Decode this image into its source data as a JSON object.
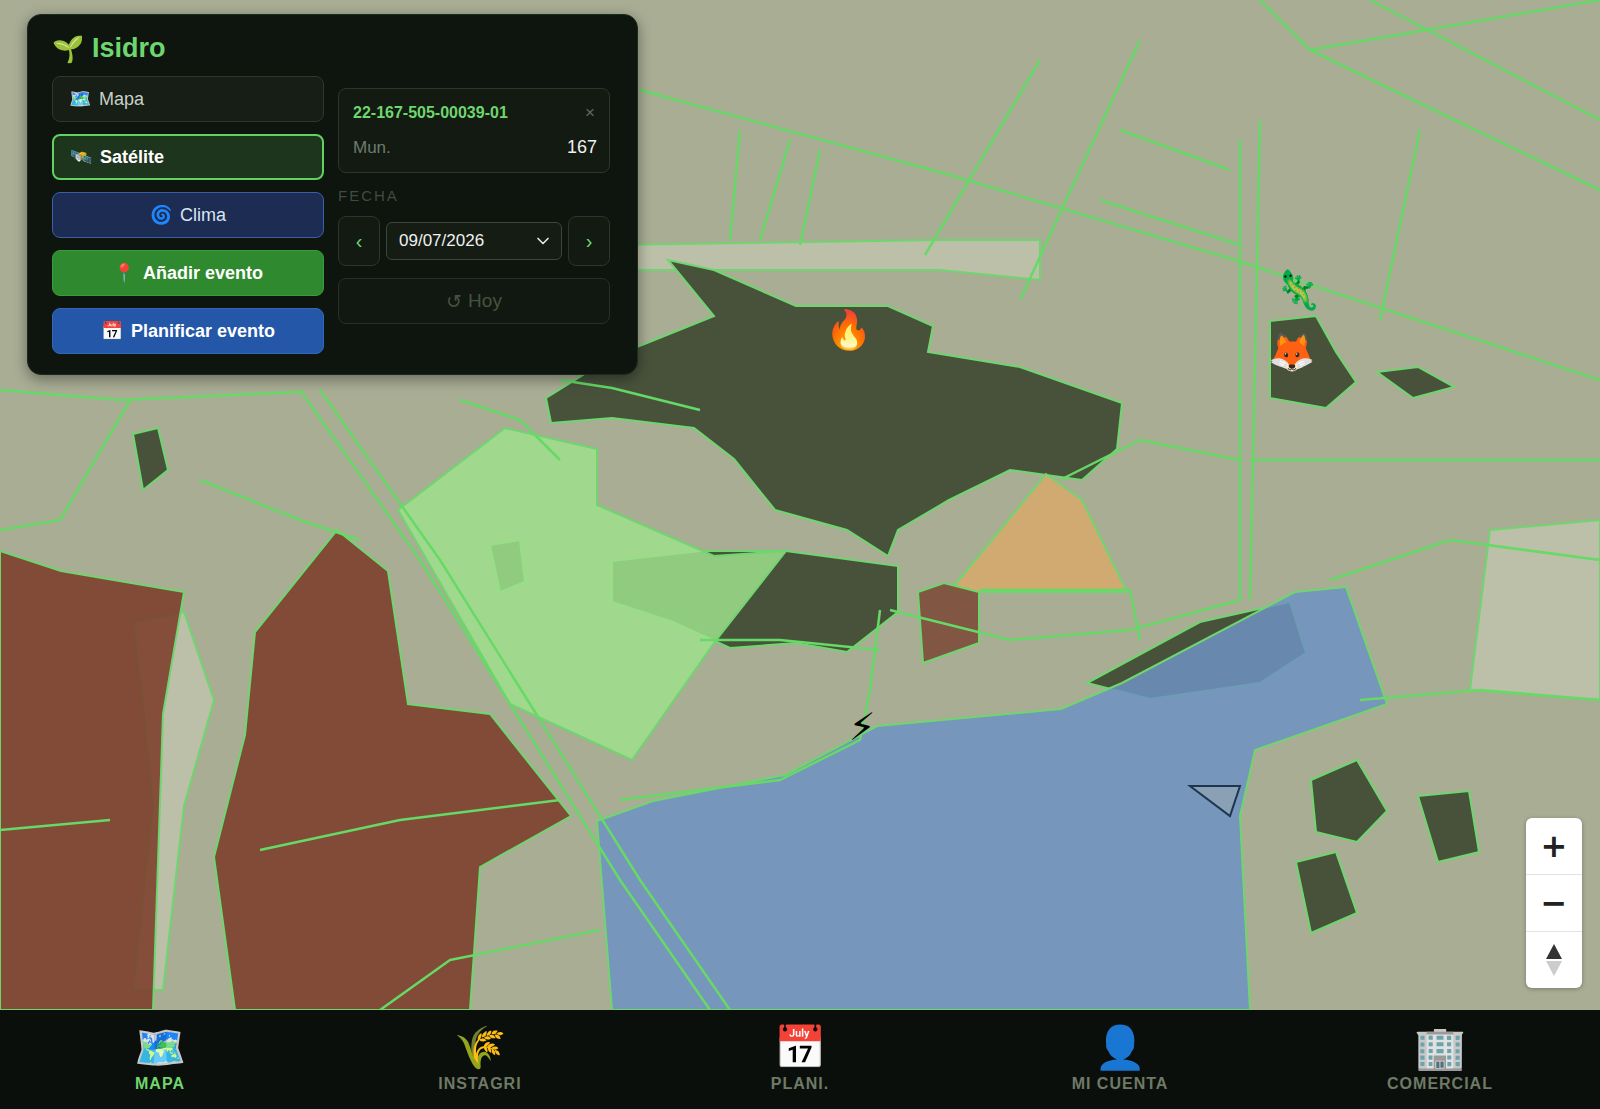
{
  "app": {
    "logo_icon": "🌱",
    "title": "Isidro"
  },
  "layers": [
    {
      "icon": "🗺️",
      "label": "Mapa",
      "selected": false
    },
    {
      "icon": "🛰️",
      "label": "Satélite",
      "selected": true
    }
  ],
  "actions": [
    {
      "icon": "🌀",
      "label": "Clima",
      "kind": "climate"
    },
    {
      "icon": "📍",
      "label": "Añadir evento",
      "kind": "add"
    },
    {
      "icon": "📅",
      "label": "Planificar evento",
      "kind": "plan"
    }
  ],
  "parcel": {
    "id": "22-167-505-00039-01",
    "close": "×",
    "field_label": "Mun.",
    "field_value": "167"
  },
  "date": {
    "label": "FECHA",
    "prev": "‹",
    "value": "09/07/2026",
    "next": "›",
    "today": {
      "icon": "↺",
      "label": "Hoy",
      "disabled": true
    }
  },
  "map": {
    "parcels": [
      {
        "color": "#9fe08c"
      },
      {
        "color": "#d8a96c"
      },
      {
        "color": "#7a4634"
      },
      {
        "color": "#6f92c2"
      },
      {
        "color": "#7b3a28"
      },
      {
        "color": "#7b3a28"
      }
    ],
    "markers": [
      {
        "icon": "🔥"
      },
      {
        "icon": "🦎"
      },
      {
        "icon": "🦊"
      },
      {
        "icon": "⚡"
      }
    ]
  },
  "zoom": {
    "in": "+",
    "out": "−"
  },
  "nav": [
    {
      "icon": "🗺️",
      "label": "MAPA",
      "selected": true
    },
    {
      "icon": "🌾",
      "label": "INSTAGRI",
      "selected": false
    },
    {
      "icon": "📅",
      "label": "PLANI.",
      "selected": false
    },
    {
      "icon": "👤",
      "label": "MI CUENTA",
      "selected": false
    },
    {
      "icon": "🏢",
      "label": "COMERCIAL",
      "selected": false
    }
  ]
}
